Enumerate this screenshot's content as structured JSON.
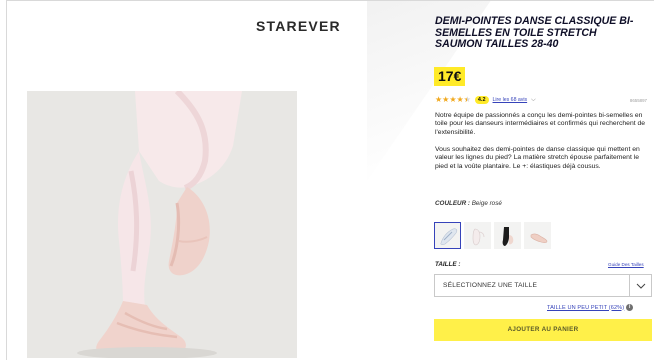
{
  "brand": "STAREVER",
  "product": {
    "title": "DEMI-POINTES DANSE CLASSIQUE BI-SEMELLES EN TOILE STRETCH SAUMON TAILLES 28-40",
    "price": "17€",
    "rating": {
      "score": "4.2",
      "stars_value": 4.2,
      "reviews_link": "Lire les 68 avis",
      "reference": "8655897"
    },
    "description_1": "Notre équipe de passionnés a conçu les demi-pointes bi-semelles en toile pour les danseurs intermédiaires et confirmés qui recherchent de l'extensibilité.",
    "description_2": "Vous souhaitez des demi-pointes de danse classique qui mettent en valeur les lignes du pied? La matière stretch épouse parfaitement le pied et la voûte plantaire. Le +: élastiques déjà cousus."
  },
  "color": {
    "label": "COULEUR :",
    "value": "Beige rosé",
    "swatches": [
      "beige-rose",
      "white",
      "black",
      "salmon"
    ]
  },
  "size": {
    "label": "TAILLE :",
    "guide_link": "Guide Des Tailles",
    "select_placeholder": "SÉLECTIONNEZ UNE TAILLE",
    "fit_link": "TAILLE UN PEU PETIT (62%)",
    "fit_icon": "info-icon"
  },
  "cart_button": "AJOUTER AU PANIER",
  "colors": {
    "accent_yellow": "#ffea28",
    "link_blue": "#3643ba",
    "star_orange": "#f1a81c"
  }
}
